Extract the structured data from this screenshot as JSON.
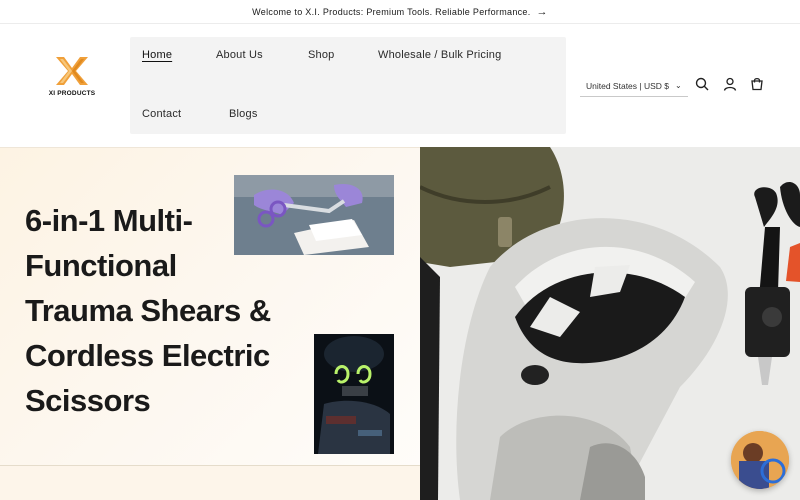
{
  "announcement": {
    "text": "Welcome to X.I. Products: Premium Tools. Reliable Performance.",
    "arrow_icon": "arrow-right-icon"
  },
  "header": {
    "logo_text": "XI PRODUCTS",
    "brand_color": "#f0a03a",
    "nav": [
      {
        "label": "Home",
        "active": true
      },
      {
        "label": "About Us"
      },
      {
        "label": "Shop"
      },
      {
        "label": "Wholesale / Bulk Pricing"
      },
      {
        "label": "Contact"
      },
      {
        "label": "Blogs"
      }
    ],
    "country_selector": "United States | USD $",
    "icons": [
      "search-icon",
      "account-icon",
      "cart-icon"
    ]
  },
  "hero": {
    "headline_lines": [
      "6-in-1 Multi-",
      "Functional",
      "Trauma Shears &",
      "Cordless Electric",
      "Scissors"
    ],
    "background_color": "#fdf5ea"
  },
  "product_marking": "XI PRODUCTS"
}
